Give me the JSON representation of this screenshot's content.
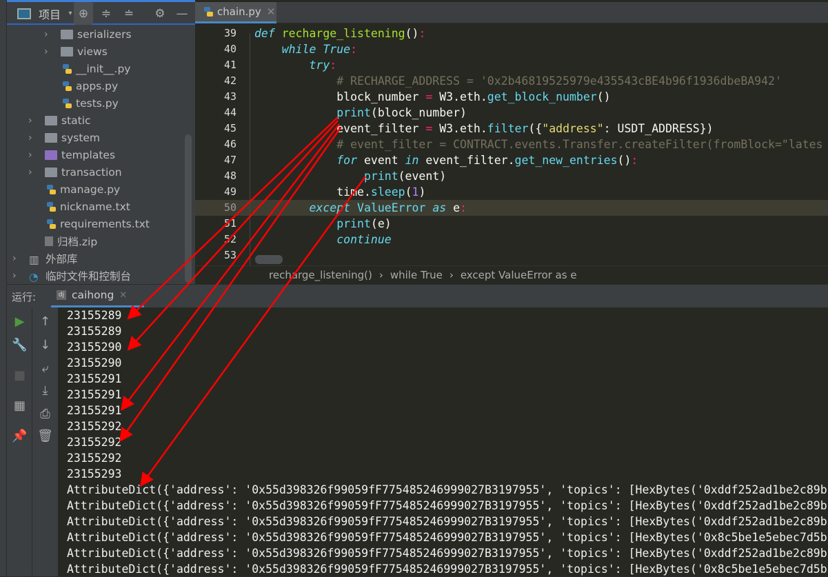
{
  "project_panel": {
    "title": "项目",
    "tree": [
      {
        "label": "serializers",
        "type": "folder",
        "indent": 2,
        "expandable": true
      },
      {
        "label": "views",
        "type": "folder",
        "indent": 2,
        "expandable": true
      },
      {
        "label": "__init__.py",
        "type": "py",
        "indent": 2,
        "expandable": false
      },
      {
        "label": "apps.py",
        "type": "py",
        "indent": 2,
        "expandable": false
      },
      {
        "label": "tests.py",
        "type": "py",
        "indent": 2,
        "expandable": false
      },
      {
        "label": "static",
        "type": "folder",
        "indent": 1,
        "expandable": true
      },
      {
        "label": "system",
        "type": "folder",
        "indent": 1,
        "expandable": true
      },
      {
        "label": "templates",
        "type": "folder-purple",
        "indent": 1,
        "expandable": true
      },
      {
        "label": "transaction",
        "type": "folder",
        "indent": 1,
        "expandable": true
      },
      {
        "label": "manage.py",
        "type": "py",
        "indent": 1,
        "expandable": false
      },
      {
        "label": "nickname.txt",
        "type": "py",
        "indent": 1,
        "expandable": false
      },
      {
        "label": "requirements.txt",
        "type": "py",
        "indent": 1,
        "expandable": false
      },
      {
        "label": "归档.zip",
        "type": "zip",
        "indent": 1,
        "expandable": false
      },
      {
        "label": "外部库",
        "type": "lib",
        "indent": 0,
        "expandable": true
      },
      {
        "label": "临时文件和控制台",
        "type": "scratch",
        "indent": 0,
        "expandable": true
      }
    ]
  },
  "editor": {
    "tab": "chain.py",
    "current_line": 50,
    "lines": [
      {
        "n": 39,
        "tokens": [
          [
            "def ",
            "kw"
          ],
          [
            "recharge_listening",
            "fn"
          ],
          [
            "()",
            ""
          ],
          [
            ":",
            "op"
          ]
        ]
      },
      {
        "n": 40,
        "tokens": [
          [
            "    ",
            ""
          ],
          [
            "while ",
            "kw"
          ],
          [
            "True",
            "kw"
          ],
          [
            ":",
            "op"
          ]
        ]
      },
      {
        "n": 41,
        "tokens": [
          [
            "        ",
            ""
          ],
          [
            "try",
            "kw"
          ],
          [
            ":",
            "op"
          ]
        ]
      },
      {
        "n": 42,
        "tokens": [
          [
            "            ",
            ""
          ],
          [
            "# RECHARGE_ADDRESS = '0x2b46819525979e435543cBE4b96f1936dbeBA942'",
            "cm"
          ]
        ]
      },
      {
        "n": 43,
        "tokens": [
          [
            "            block_number ",
            ""
          ],
          [
            "=",
            "op"
          ],
          [
            " W3.eth.",
            ""
          ],
          [
            "get_block_number",
            "bi"
          ],
          [
            "()",
            ""
          ]
        ]
      },
      {
        "n": 44,
        "tokens": [
          [
            "            ",
            ""
          ],
          [
            "print",
            "bi"
          ],
          [
            "(block_number)",
            ""
          ]
        ]
      },
      {
        "n": 45,
        "tokens": [
          [
            "            event_filter ",
            ""
          ],
          [
            "=",
            "op"
          ],
          [
            " W3.eth.",
            ""
          ],
          [
            "filter",
            "bi"
          ],
          [
            "({",
            ""
          ],
          [
            "\"address\"",
            "st"
          ],
          [
            ": USDT_ADDRESS})",
            ""
          ]
        ]
      },
      {
        "n": 46,
        "tokens": [
          [
            "            ",
            ""
          ],
          [
            "# event_filter = CONTRACT.events.Transfer.createFilter(fromBlock=\"lates",
            "cm"
          ]
        ]
      },
      {
        "n": 47,
        "tokens": [
          [
            "            ",
            ""
          ],
          [
            "for ",
            "kw"
          ],
          [
            "event ",
            ""
          ],
          [
            "in ",
            "kw"
          ],
          [
            "event_filter.",
            ""
          ],
          [
            "get_new_entries",
            "bi"
          ],
          [
            "()",
            ""
          ],
          [
            ":",
            "op"
          ]
        ]
      },
      {
        "n": 48,
        "tokens": [
          [
            "                ",
            ""
          ],
          [
            "print",
            "bi"
          ],
          [
            "(event)",
            ""
          ]
        ]
      },
      {
        "n": 49,
        "tokens": [
          [
            "            time.",
            ""
          ],
          [
            "sleep",
            "bi"
          ],
          [
            "(",
            ""
          ],
          [
            "1",
            "nm"
          ],
          [
            ")",
            ""
          ]
        ]
      },
      {
        "n": 50,
        "tokens": [
          [
            "        ",
            ""
          ],
          [
            "except ",
            "kw"
          ],
          [
            "ValueError ",
            "bi"
          ],
          [
            "as ",
            "kw"
          ],
          [
            "e",
            ""
          ],
          [
            ":",
            "op"
          ]
        ]
      },
      {
        "n": 51,
        "tokens": [
          [
            "            ",
            ""
          ],
          [
            "print",
            "bi"
          ],
          [
            "(e)",
            ""
          ]
        ]
      },
      {
        "n": 52,
        "tokens": [
          [
            "            ",
            ""
          ],
          [
            "continue",
            "kw"
          ]
        ]
      },
      {
        "n": 53,
        "tokens": []
      }
    ],
    "breadcrumbs": [
      "recharge_listening()",
      "while True",
      "except ValueError as e"
    ]
  },
  "run_panel": {
    "label": "运行:",
    "tab": "caihong",
    "output": [
      "23155289",
      "23155289",
      "23155290",
      "23155290",
      "23155291",
      "23155291",
      "23155291",
      "23155292",
      "23155292",
      "23155292",
      "23155293",
      "AttributeDict({'address': '0x55d398326f99059fF775485246999027B3197955', 'topics': [HexBytes('0xddf252ad1be2c89b",
      "AttributeDict({'address': '0x55d398326f99059fF775485246999027B3197955', 'topics': [HexBytes('0xddf252ad1be2c89b",
      "AttributeDict({'address': '0x55d398326f99059fF775485246999027B3197955', 'topics': [HexBytes('0xddf252ad1be2c89b",
      "AttributeDict({'address': '0x55d398326f99059fF775485246999027B3197955', 'topics': [HexBytes('0x8c5be1e5ebec7d5b",
      "AttributeDict({'address': '0x55d398326f99059fF775485246999027B3197955', 'topics': [HexBytes('0xddf252ad1be2c89b",
      "AttributeDict({'address': '0x55d398326f99059fF775485246999027B3197955', 'topics': [HexBytes('0x8c5be1e5ebec7d5b"
    ]
  },
  "colors": {
    "accent": "#4a88c7",
    "annotation": "#ff0000",
    "run": "#4e9a3e"
  }
}
